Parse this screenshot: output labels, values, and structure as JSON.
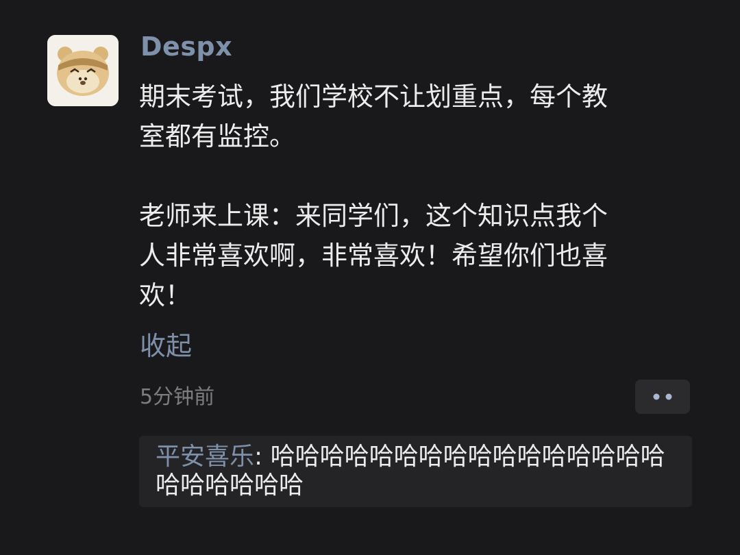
{
  "post": {
    "username": "Despx",
    "paragraphs": [
      "期末考试，我们学校不让划重点，每个教\n室都有监控。",
      "老师来上课：来同学们，这个知识点我个\n人非常喜欢啊，非常喜欢！希望你们也喜\n欢！"
    ],
    "collapse_label": "收起",
    "timestamp": "5分钟前"
  },
  "icons": {
    "avatar": "bear-avatar",
    "more": "more-dots-icon"
  },
  "comments": [
    {
      "author": "平安喜乐",
      "separator": ": ",
      "text": "哈哈哈哈哈哈哈哈哈哈哈哈哈哈哈哈哈哈哈哈哈哈"
    }
  ],
  "colors": {
    "background": "#19191b",
    "link": "#7e90aa",
    "text": "#ececec",
    "muted": "#7d7d80",
    "panel": "#242426"
  }
}
